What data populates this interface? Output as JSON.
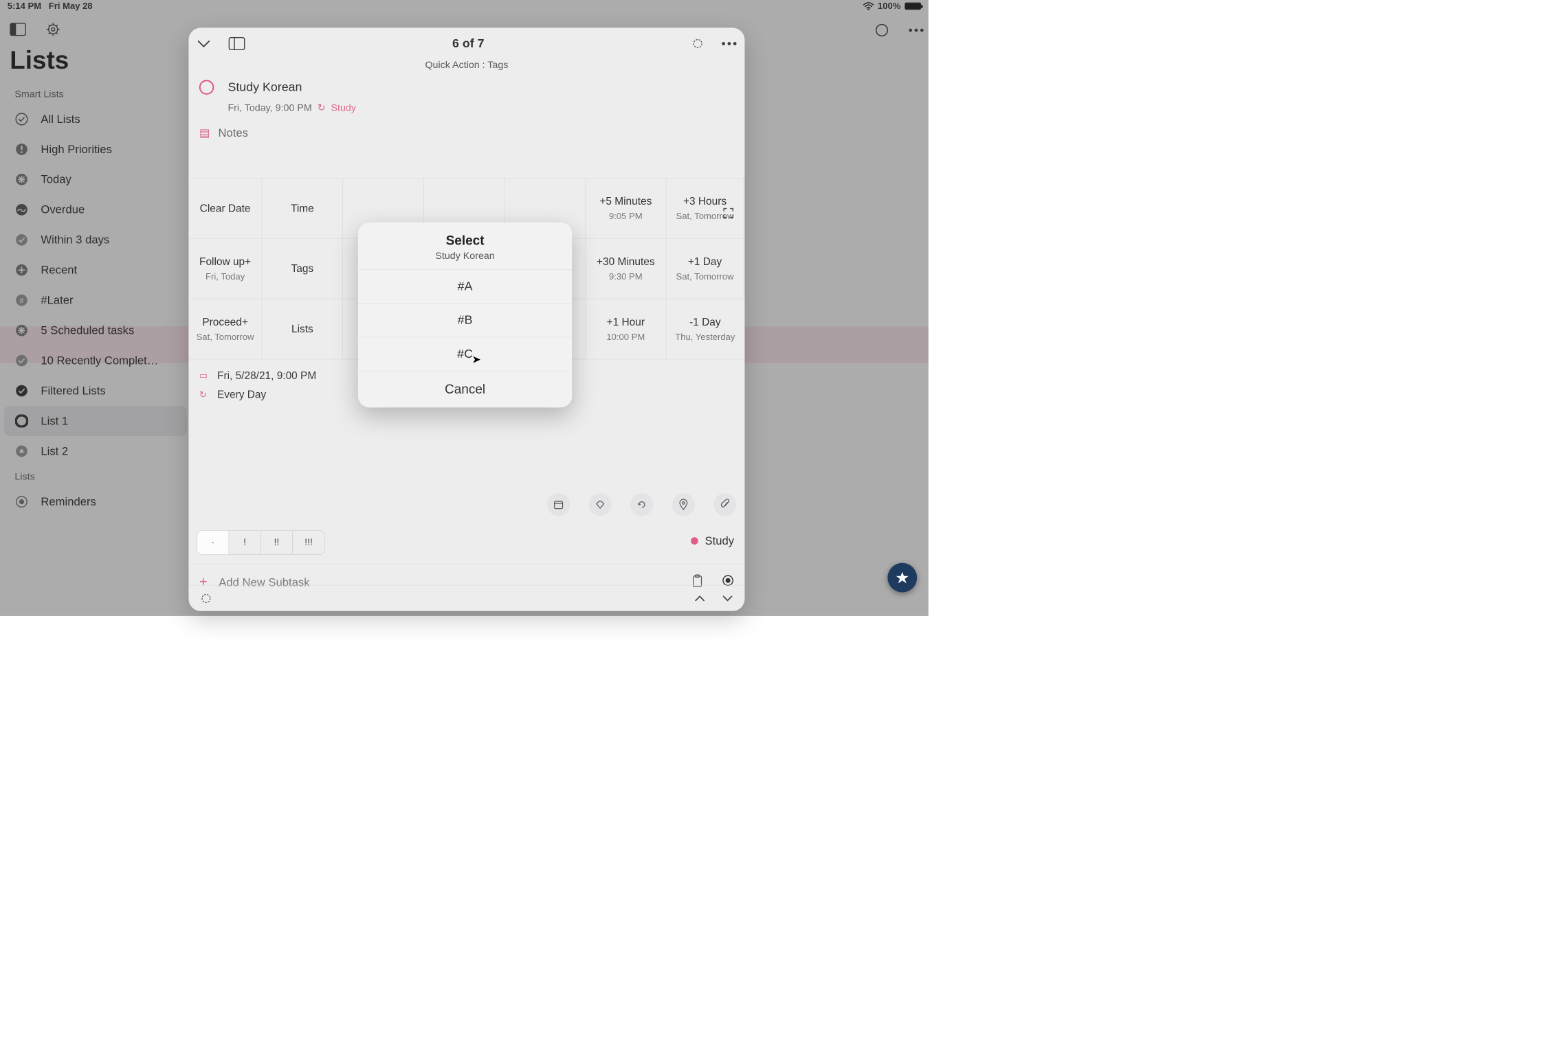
{
  "status": {
    "time": "5:14 PM",
    "date": "Fri May 28",
    "wifi": "wifi",
    "batt": "100%"
  },
  "sidebar": {
    "title": "Lists",
    "group1": "Smart Lists",
    "items": [
      {
        "label": "All Lists"
      },
      {
        "label": "High Priorities"
      },
      {
        "label": "Today"
      },
      {
        "label": "Overdue"
      },
      {
        "label": "Within 3 days"
      },
      {
        "label": "Recent"
      },
      {
        "label": "#Later"
      },
      {
        "label": "5 Scheduled tasks"
      },
      {
        "label": "10 Recently Complet…"
      },
      {
        "label": "Filtered Lists"
      },
      {
        "label": "List 1"
      },
      {
        "label": "List 2"
      }
    ],
    "group2": "Lists",
    "items2": [
      {
        "label": "Reminders"
      }
    ]
  },
  "detail": {
    "counter": "6 of 7",
    "quick": "Quick Action : Tags",
    "task": "Study Korean",
    "meta_date": "Fri, Today, 9:00 PM",
    "meta_list": "Study",
    "notes": "Notes",
    "tableRow1": [
      {
        "big": "Clear Date",
        "sm": ""
      },
      {
        "big": "Time",
        "sm": ""
      },
      {
        "big": "",
        "sm": ""
      },
      {
        "big": "",
        "sm": ""
      },
      {
        "big": "",
        "sm": ""
      },
      {
        "big": "+5 Minutes",
        "sm": "9:05 PM"
      },
      {
        "big": "+3 Hours",
        "sm": "Sat, Tomorrow"
      }
    ],
    "tableRow2": [
      {
        "big": "Follow up+",
        "sm": "Fri, Today"
      },
      {
        "big": "Tags",
        "sm": ""
      },
      {
        "big": "",
        "sm": ""
      },
      {
        "big": "",
        "sm": ""
      },
      {
        "big": "",
        "sm": ""
      },
      {
        "big": "+30 Minutes",
        "sm": "9:30 PM"
      },
      {
        "big": "+1 Day",
        "sm": "Sat, Tomorrow"
      }
    ],
    "tableRow3": [
      {
        "big": "Proceed+",
        "sm": "Sat, Tomorrow"
      },
      {
        "big": "Lists",
        "sm": ""
      },
      {
        "big": "",
        "sm": ""
      },
      {
        "big": "",
        "sm": ""
      },
      {
        "big": "",
        "sm": ""
      },
      {
        "big": "+1 Hour",
        "sm": "10:00 PM"
      },
      {
        "big": "-1 Day",
        "sm": "Thu, Yesterday"
      }
    ],
    "fullDate": "Fri, 5/28/21, 9:00 PM",
    "repeat": "Every Day",
    "priority": [
      "·",
      "!",
      "!!",
      "!!!"
    ],
    "listBadge": "Study",
    "addSubtask": "Add New Subtask"
  },
  "popup": {
    "title": "Select",
    "subtitle": "Study Korean",
    "items": [
      "#A",
      "#B",
      "#C"
    ],
    "cancel": "Cancel"
  }
}
